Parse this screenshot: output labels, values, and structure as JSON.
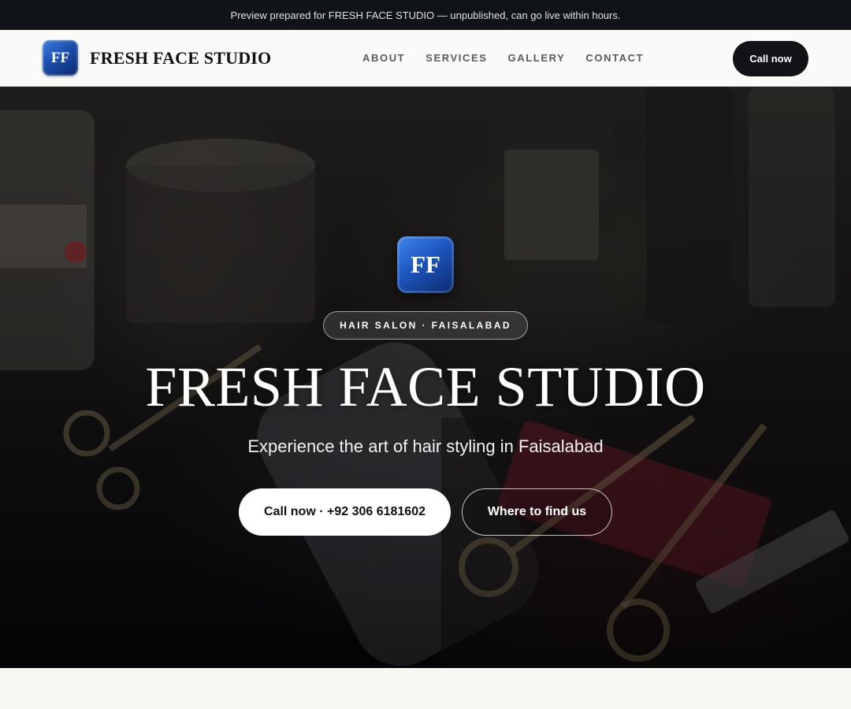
{
  "preview_bar": {
    "text": "Preview prepared for FRESH FACE STUDIO — unpublished, can go live within hours."
  },
  "header": {
    "logo_text": "FF",
    "brand_name": "FRESH FACE STUDIO",
    "nav": [
      {
        "label": "ABOUT"
      },
      {
        "label": "SERVICES"
      },
      {
        "label": "GALLERY"
      },
      {
        "label": "CONTACT"
      }
    ],
    "cta_label": "Call now"
  },
  "hero": {
    "logo_text": "FF",
    "tag": "HAIR SALON · FAISALABAD",
    "title": "FRESH FACE STUDIO",
    "subtitle": "Experience the art of hair styling in Faisalabad",
    "primary_button": "Call now · +92 306 6181602",
    "secondary_button": "Where to find us",
    "background_image": "barber-tools-photo"
  },
  "colors": {
    "brand_blue": "#1b4fad",
    "dark": "#111316",
    "page_bg": "#f8f7f4"
  }
}
